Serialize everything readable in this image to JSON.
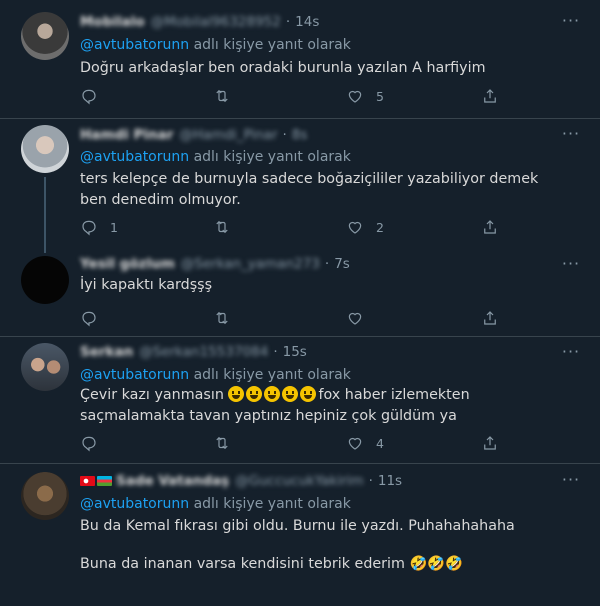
{
  "tweets": [
    {
      "name": "Mobilalo",
      "handle": "@Mobilal96328952",
      "time": "14s",
      "reply_prefix": "",
      "reply_mention": "@avtubatorunn",
      "reply_suffix": " adlı kişiye yanıt olarak",
      "text": "Doğru arkadaşlar ben oradaki burunla yazılan A harfiyim",
      "replies": "",
      "retweets": "",
      "likes": "5"
    },
    {
      "name": "Hamdi Pinar",
      "handle": "@Hamdi_Pinar",
      "time": "8s",
      "reply_mention": "@avtubatorunn",
      "reply_suffix": " adlı kişiye yanıt olarak",
      "text": "ters kelepçe de burnuyla sadece boğaziçililer yazabiliyor demek ben denedim olmuyor.",
      "replies": "1",
      "retweets": "",
      "likes": "2"
    },
    {
      "name": "Yesil gözlum",
      "handle": "@Serkan_yaman273",
      "time": "7s",
      "text": "İyi kapaktı kardşşş",
      "replies": "",
      "retweets": "",
      "likes": ""
    },
    {
      "name": "Serkan",
      "handle": "@Serkan15537084",
      "time": "15s",
      "reply_mention": "@avtubatorunn",
      "reply_suffix": " adlı kişiye yanıt olarak",
      "text_a": "Çevir kazı yanmasın ",
      "text_b": "fox haber izlemekten saçmalamakta tavan yaptınız hepiniz çok güldüm ya",
      "replies": "",
      "retweets": "",
      "likes": "4"
    },
    {
      "name": "Sade Vatandaş",
      "handle": "@GuccucukYakirim",
      "time": "11s",
      "reply_mention": "@avtubatorunn",
      "reply_suffix": " adlı kişiye yanıt olarak",
      "text_1": "Bu da Kemal fıkrası gibi oldu.  Burnu ile yazdı. Puhahahahaha",
      "text_2": "Buna da inanan varsa kendisini tebrik ederim ",
      "text_2_emoji": "🤣🤣🤣",
      "replies": "",
      "retweets": "",
      "likes": ""
    }
  ],
  "more_glyph": "···"
}
